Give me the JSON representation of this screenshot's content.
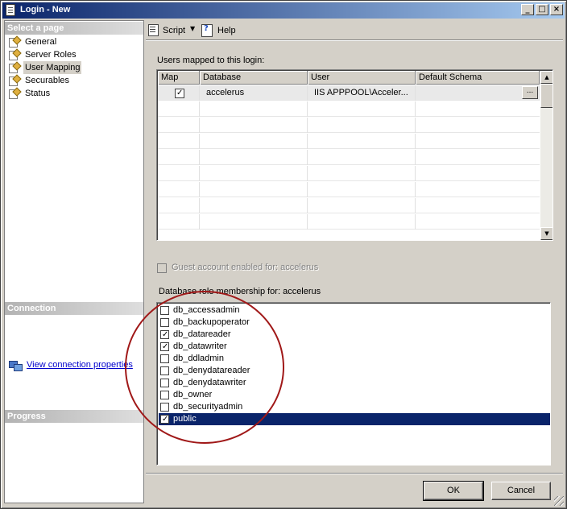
{
  "window": {
    "title": "Login - New",
    "controls": {
      "minimize": "_",
      "maximize": "□",
      "close": "×"
    }
  },
  "sidebar": {
    "select_page_header": "Select a page",
    "pages": [
      {
        "label": "General",
        "selected": false
      },
      {
        "label": "Server Roles",
        "selected": false
      },
      {
        "label": "User Mapping",
        "selected": true
      },
      {
        "label": "Securables",
        "selected": false
      },
      {
        "label": "Status",
        "selected": false
      }
    ],
    "connection_header": "Connection",
    "connection_link": "View connection properties",
    "progress_header": "Progress"
  },
  "toolbar": {
    "script_label": "Script",
    "help_label": "Help"
  },
  "users_mapped": {
    "label": "Users mapped to this login:",
    "columns": [
      "Map",
      "Database",
      "User",
      "Default Schema"
    ],
    "rows": [
      {
        "map": true,
        "database": "accelerus",
        "user": "IIS APPPOOL\\Acceler...",
        "default_schema": "",
        "ellipsis": "..."
      }
    ]
  },
  "guest": {
    "label": "Guest account enabled for: accelerus",
    "checked": false,
    "enabled": false
  },
  "role_membership": {
    "label": "Database role membership for: accelerus",
    "roles": [
      {
        "name": "db_accessadmin",
        "checked": false
      },
      {
        "name": "db_backupoperator",
        "checked": false
      },
      {
        "name": "db_datareader",
        "checked": true
      },
      {
        "name": "db_datawriter",
        "checked": true
      },
      {
        "name": "db_ddladmin",
        "checked": false
      },
      {
        "name": "db_denydatareader",
        "checked": false
      },
      {
        "name": "db_denydatawriter",
        "checked": false
      },
      {
        "name": "db_owner",
        "checked": false
      },
      {
        "name": "db_securityadmin",
        "checked": false
      },
      {
        "name": "public",
        "checked": true,
        "selected": true
      }
    ]
  },
  "buttons": {
    "ok": "OK",
    "cancel": "Cancel"
  },
  "colors": {
    "selection": "#0a246a",
    "annotation": "#a01818",
    "link": "#0000cc"
  }
}
